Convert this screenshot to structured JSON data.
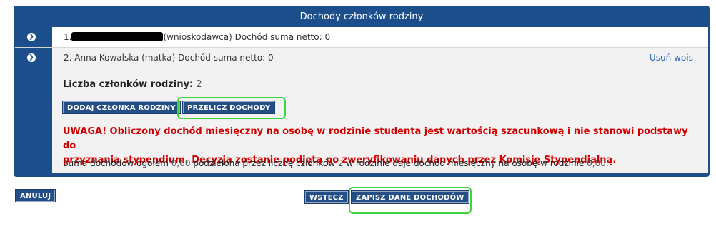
{
  "panel": {
    "title": "Dochody członków rodziny"
  },
  "members": [
    {
      "number": "1.",
      "role": "(wnioskodawca)",
      "income_label": "Dochód suma netto:",
      "income_value": "0"
    },
    {
      "text": "2. Anna Kowalska (matka) Dochód suma netto: 0",
      "remove_label": "Usuń wpis"
    }
  ],
  "count": {
    "label": "Liczba członków rodziny:",
    "value": "2"
  },
  "buttons": {
    "add_member": "DODAJ CZŁONKA RODZINY",
    "recalculate": "PRZELICZ DOCHODY",
    "cancel": "ANULUJ",
    "back": "WSTECZ",
    "save": "ZAPISZ DANE DOCHODÓW"
  },
  "warning": {
    "line1": "UWAGA! Obliczony dochód miesięczny na osobę w rodzinie studenta jest wartością szacunkową i nie stanowi podstawy do",
    "line2": "przyznania stypendium. Decyzja zostanie podjęta po zweryfikowaniu danych przez Komisję Stypendialną."
  },
  "summary": {
    "part1": "Suma dochodów ogółem",
    "total": "0,00",
    "part2": "podzielona przez liczbę członków",
    "members": "2",
    "part3": "w rodzinie daje dochód miesięczny na osobę w rodzinie",
    "per_person": "0,00",
    "end": "."
  },
  "colors": {
    "primary": "#1d4e8c",
    "warning": "#d00000",
    "highlight": "#3cd63c",
    "link": "#2a6ac1"
  }
}
